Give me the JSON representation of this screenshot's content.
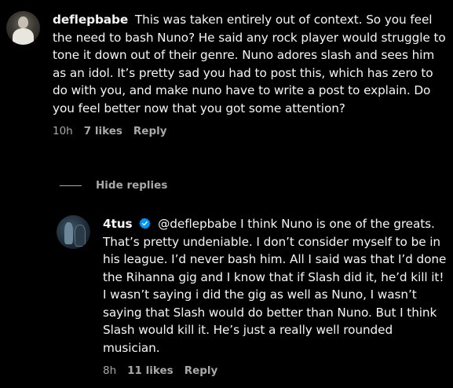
{
  "comments": [
    {
      "username": "deflepbabe",
      "text": "This was taken entirely out of context. So you feel the need to bash Nuno? He said any rock player would struggle to tone it down out of their genre. Nuno adores slash and sees him as an idol. It’s pretty sad you had to post this, which has zero to do with you, and make nuno have to write a post to explain. Do you feel better now that you got some attention?",
      "time": "10h",
      "likes": "7 likes",
      "reply": "Reply"
    }
  ],
  "hide_replies": "Hide replies",
  "replies": [
    {
      "username": "4tus",
      "verified": true,
      "text": "@deflepbabe I think Nuno is one of the greats. That’s pretty undeniable. I don’t consider myself to be in his league. I’d never bash him. All I said was that I’d done the Rihanna gig and I know that if Slash did it, he’d kill it! I wasn’t saying i did the gig as well as Nuno, I wasn’t saying that Slash would do better than Nuno. But I think Slash would kill it. He’s just a really well rounded musician.",
      "time": "8h",
      "likes": "11 likes",
      "reply": "Reply"
    }
  ],
  "colors": {
    "background": "#000000",
    "text": "#f5f5f5",
    "secondary": "#a8a8a8",
    "verified": "#0095f6"
  }
}
